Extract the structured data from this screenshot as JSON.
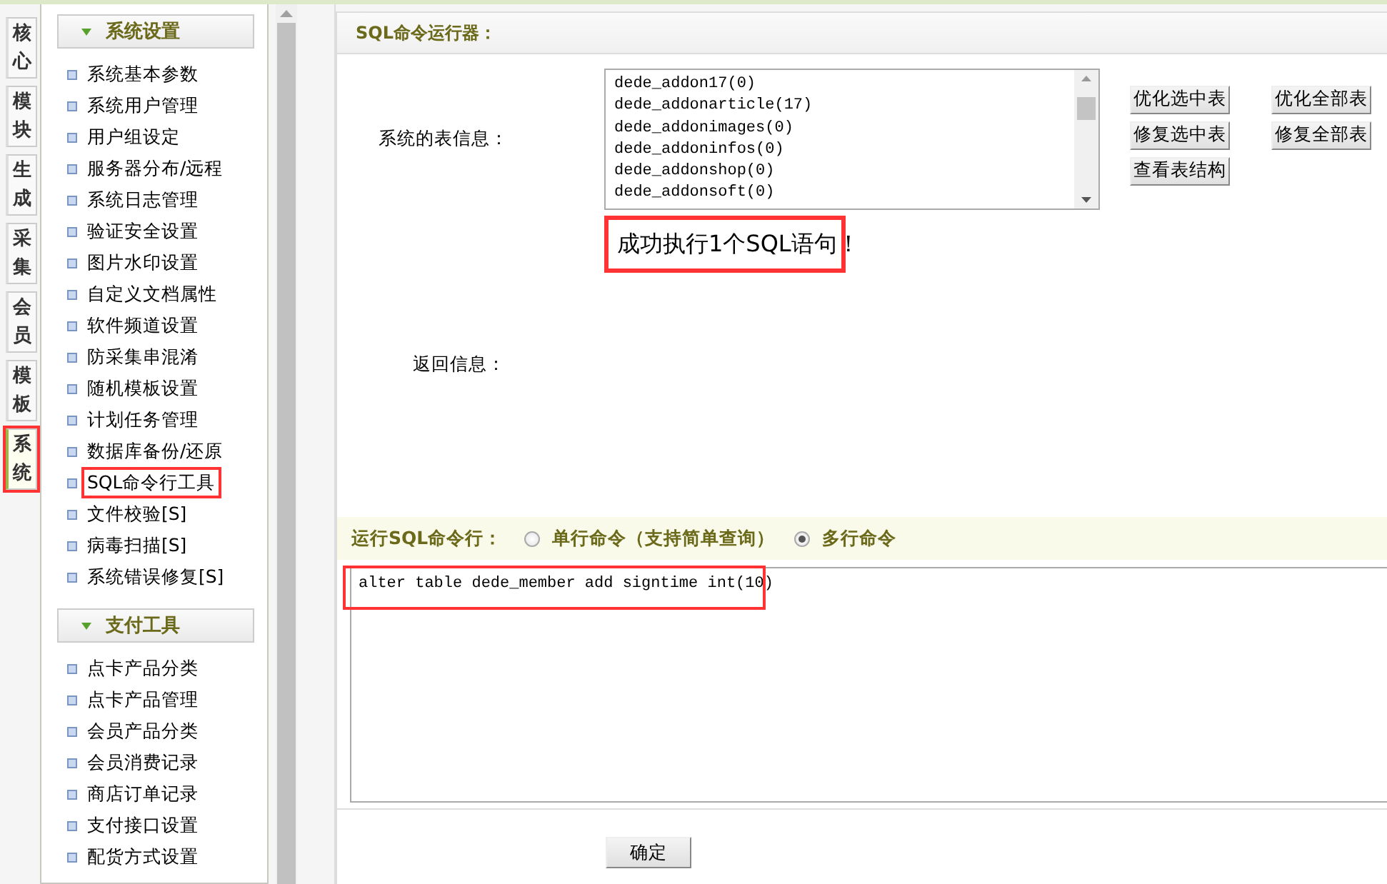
{
  "side_tabs": [
    {
      "label": "核心",
      "selected": false,
      "highlighted": false
    },
    {
      "label": "模块",
      "selected": false,
      "highlighted": false
    },
    {
      "label": "生成",
      "selected": false,
      "highlighted": false
    },
    {
      "label": "采集",
      "selected": false,
      "highlighted": false
    },
    {
      "label": "会员",
      "selected": false,
      "highlighted": false
    },
    {
      "label": "模板",
      "selected": false,
      "highlighted": false
    },
    {
      "label": "系统",
      "selected": true,
      "highlighted": true
    }
  ],
  "menu_sections": [
    {
      "title": "系统设置",
      "expanded": true,
      "items": [
        {
          "label": "系统基本参数",
          "highlighted": false
        },
        {
          "label": "系统用户管理",
          "highlighted": false
        },
        {
          "label": "用户组设定",
          "highlighted": false
        },
        {
          "label": "服务器分布/远程",
          "highlighted": false
        },
        {
          "label": "系统日志管理",
          "highlighted": false
        },
        {
          "label": "验证安全设置",
          "highlighted": false
        },
        {
          "label": "图片水印设置",
          "highlighted": false
        },
        {
          "label": "自定义文档属性",
          "highlighted": false
        },
        {
          "label": "软件频道设置",
          "highlighted": false
        },
        {
          "label": "防采集串混淆",
          "highlighted": false
        },
        {
          "label": "随机模板设置",
          "highlighted": false
        },
        {
          "label": "计划任务管理",
          "highlighted": false
        },
        {
          "label": "数据库备份/还原",
          "highlighted": false
        },
        {
          "label": "SQL命令行工具",
          "highlighted": true
        },
        {
          "label": "文件校验[S]",
          "highlighted": false
        },
        {
          "label": "病毒扫描[S]",
          "highlighted": false
        },
        {
          "label": "系统错误修复[S]",
          "highlighted": false
        }
      ]
    },
    {
      "title": "支付工具",
      "expanded": true,
      "items": [
        {
          "label": "点卡产品分类",
          "highlighted": false
        },
        {
          "label": "点卡产品管理",
          "highlighted": false
        },
        {
          "label": "会员产品分类",
          "highlighted": false
        },
        {
          "label": "会员消费记录",
          "highlighted": false
        },
        {
          "label": "商店订单记录",
          "highlighted": false
        },
        {
          "label": "支付接口设置",
          "highlighted": false
        },
        {
          "label": "配货方式设置",
          "highlighted": false
        }
      ]
    }
  ],
  "panel": {
    "title": "SQL命令运行器：",
    "table_info_label": "系统的表信息：",
    "tables": [
      "dede_addon17(0)",
      "dede_addonarticle(17)",
      "dede_addonimages(0)",
      "dede_addoninfos(0)",
      "dede_addonshop(0)",
      "dede_addonsoft(0)"
    ],
    "table_buttons": [
      "优化选中表",
      "优化全部表",
      "修复选中表",
      "修复全部表",
      "查看表结构"
    ],
    "result_message": {
      "text": "成功执行1个SQL语句！",
      "highlighted": true
    },
    "return_label": "返回信息：",
    "command_bar": {
      "label": "运行SQL命令行：",
      "modes": [
        {
          "label": "单行命令（支持简单查询）",
          "selected": false
        },
        {
          "label": "多行命令",
          "selected": true
        }
      ]
    },
    "command": {
      "value": "alter table dede_member add signtime int(10)",
      "highlighted": true
    },
    "submit": "确定"
  }
}
